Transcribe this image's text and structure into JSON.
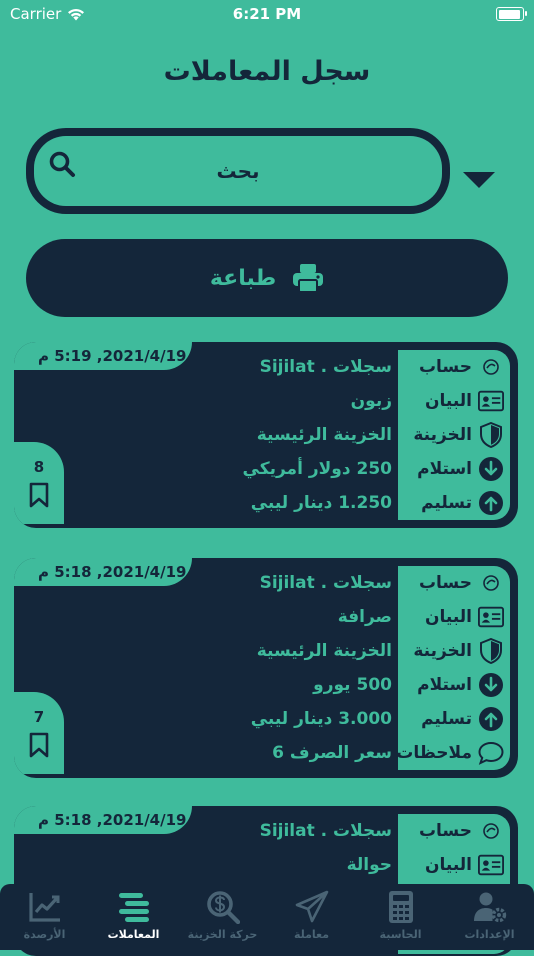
{
  "status_bar": {
    "carrier": "Carrier",
    "time": "6:21 PM"
  },
  "header": {
    "title": "سجل المعاملات"
  },
  "search": {
    "placeholder": "بحث"
  },
  "print_button": {
    "label": "طباعة"
  },
  "labels": {
    "account": "حساب",
    "statement": "البيان",
    "treasury": "الخزينة",
    "receive": "استلام",
    "deliver": "تسليم",
    "notes": "ملاحظات"
  },
  "transactions": [
    {
      "date": "2021/4/19, 5:19 م",
      "account": "سجلات . Sijilat",
      "statement": "زبون",
      "treasury": "الخزينة الرئيسية",
      "receive": "250 دولار أمريكي",
      "deliver": "1.250 دينار ليبي",
      "number": "8"
    },
    {
      "date": "2021/4/19, 5:18 م",
      "account": "سجلات . Sijilat",
      "statement": "صرافة",
      "treasury": "الخزينة الرئيسية",
      "receive": "500 يورو",
      "deliver": "3.000 دينار ليبي",
      "notes": "سعر الصرف 6",
      "number": "7"
    },
    {
      "date": "2021/4/19, 5:18 م",
      "account": "سجلات . Sijilat",
      "statement": "حوالة"
    }
  ],
  "tabs": [
    {
      "id": "settings",
      "label": "الإعدادات",
      "icon": "user-gear-icon"
    },
    {
      "id": "calculator",
      "label": "الحاسبة",
      "icon": "calculator-icon"
    },
    {
      "id": "transaction",
      "label": "معاملة",
      "icon": "paper-plane-icon"
    },
    {
      "id": "treasury-movement",
      "label": "حركة الخزينة",
      "icon": "search-dollar-icon"
    },
    {
      "id": "transactions",
      "label": "المعاملات",
      "icon": "list-icon",
      "active": true
    },
    {
      "id": "balances",
      "label": "الأرصدة",
      "icon": "chart-line-icon"
    }
  ],
  "colors": {
    "background": "#3fbb9c",
    "dark": "#14263a",
    "inactive_tab": "#4a6475"
  }
}
